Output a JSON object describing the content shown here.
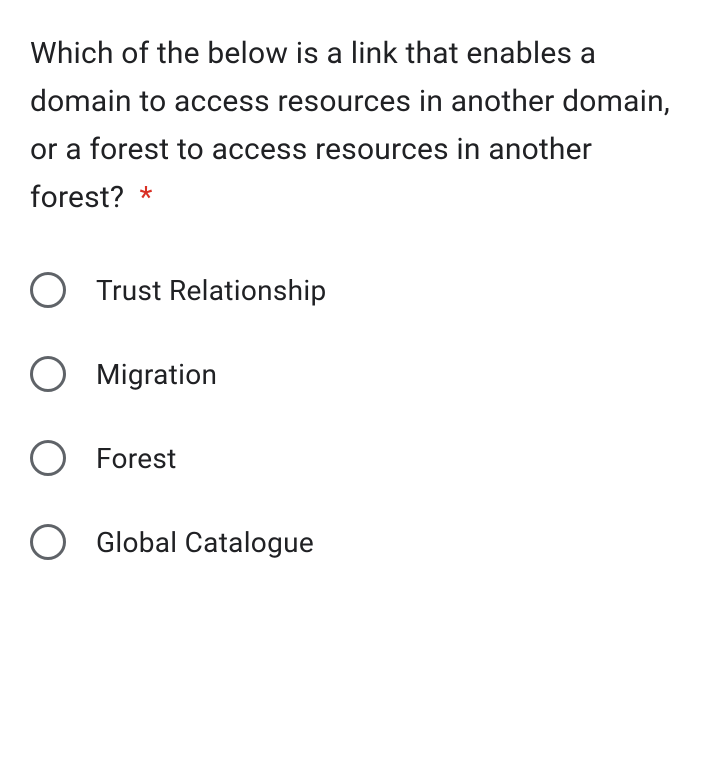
{
  "question": {
    "text": "Which of the below is a link that enables a domain to access resources in another domain, or a forest to access resources in another forest?",
    "required_marker": "*"
  },
  "options": [
    {
      "label": "Trust Relationship"
    },
    {
      "label": "Migration"
    },
    {
      "label": "Forest"
    },
    {
      "label": "Global Catalogue"
    }
  ]
}
